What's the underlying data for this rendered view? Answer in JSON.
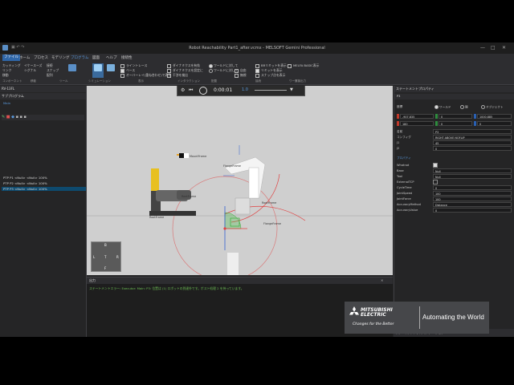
{
  "window": {
    "title": "Robot Reachability Part1_after.vcmx - MELSOFT Gemini Professional",
    "controls": [
      "—",
      "□",
      "✕"
    ]
  },
  "menu": [
    "ファイル",
    "ホーム",
    "プロセス",
    "モデリング",
    "プログラム",
    "図面",
    "ヘルプ",
    "接続性"
  ],
  "menu_active_index": 4,
  "ribbon": {
    "col1": [
      "カッティング",
      "リンク",
      "移動"
    ],
    "col2": [
      "イケースーズ",
      "シグナル",
      ""
    ],
    "col3": [
      "接続",
      "スナップ",
      "配列"
    ],
    "big_buttons": [
      "",
      "",
      ""
    ],
    "display_checks": [
      {
        "label": "ライントレース",
        "on": false
      },
      {
        "label": "ベース",
        "on": true
      },
      {
        "label": "オーバーレイ(重ね合わせ)で表示",
        "on": false
      }
    ],
    "dynamics_checks": [
      {
        "label": "ダイナミクスを有効",
        "on": false
      },
      {
        "label": "ダイナミクスを設定に",
        "on": false
      },
      {
        "label": "干渉を検出",
        "on": false
      }
    ],
    "work_radios": [
      {
        "label": "ワールドに対して",
        "on": true
      },
      {
        "label": "ワールドに対して",
        "on": false
      }
    ],
    "snap_checks": [
      {
        "label": "自由",
        "on": false
      },
      {
        "label": "無視",
        "on": false
      }
    ],
    "bounds_checks": [
      {
        "label": "BRリミットを表示",
        "on": false
      },
      {
        "label": "リミットを表示",
        "on": true
      },
      {
        "label": "スナップ点を表示",
        "on": false
      }
    ],
    "mode_check": {
      "label": "MELFA BASIC表示",
      "on": false
    },
    "groups": [
      "コンポーネント",
      "移動",
      "ツール",
      "シミュレーション",
      "表示",
      "インタラクション",
      "配置",
      "接続",
      "ワーク",
      "実機出力"
    ]
  },
  "left_panel": {
    "header": "RV-13FL",
    "subprogram_header": "サブプログラム",
    "subprogram_item": "Main",
    "statements": [
      "PTP P1 <Null> <Null> 100%",
      "PTP P2 <Null> <Null> 100%",
      "PTP P3 <Null> <Null> 100%"
    ],
    "selected_index": 2
  },
  "viewport": {
    "timer": "0:00:01",
    "speed": "1.0",
    "labels": {
      "frame_a": "MountFrame",
      "frame_b": "FlangeFrame",
      "frame_c": "RootFrame",
      "frame_d": "RootFrame",
      "frame_e": "RootFrame",
      "frame_f": "FlangeFrame"
    },
    "nav_cube": {
      "top": "B",
      "left": "L",
      "right": "R",
      "bottom": "F",
      "center": "T"
    }
  },
  "output": {
    "header": "出力",
    "message": "ステートメントエラー: Executor: Main: P3: 位置は (1) ロボットの到達外です。ポスト処理 2 を持っています。"
  },
  "right_panel": {
    "header": "ステートメントプロパティ",
    "subtab": "P3",
    "coords_label": "座標",
    "coords_options": [
      {
        "label": "ワールド",
        "on": true
      },
      {
        "label": "親",
        "on": false
      },
      {
        "label": "オブジェクト",
        "on": false
      }
    ],
    "pos": {
      "x": "-907.835",
      "y": "0",
      "z": "1000.885"
    },
    "rot": {
      "rx": "180",
      "ry": "0",
      "rz": "0"
    },
    "fields": [
      {
        "label": "名前",
        "value": "P3"
      },
      {
        "label": "コンフィグ",
        "value": "RIGHT ABOVE NOFLIP"
      },
      {
        "label": "J1",
        "value": "45"
      },
      {
        "label": "J2",
        "value": "0"
      }
    ],
    "section": "プロパティ",
    "props": [
      {
        "label": "Whatnot",
        "value": "",
        "check": true
      },
      {
        "label": "Base",
        "value": "Null"
      },
      {
        "label": "Tool",
        "value": "Null"
      },
      {
        "label": "ExternalTCP",
        "value": "",
        "check": false
      },
      {
        "label": "CycleTime",
        "value": "0"
      },
      {
        "label": "JointSpeed",
        "value": "100"
      },
      {
        "label": "JointForce",
        "value": "100"
      },
      {
        "label": "AccuracyMethod",
        "value": "Distance"
      },
      {
        "label": "AccuracyValue",
        "value": "0"
      }
    ],
    "bottom_tabs": [
      "ステートメントプロパティ",
      "ジョグ"
    ]
  },
  "logo": {
    "brand1": "MITSUBISHI",
    "brand2": "ELECTRIC",
    "tagline": "Changes for the Better",
    "slogan": "Automating the World"
  },
  "colors": {
    "accent": "#2f66a8",
    "selection": "#0e4a6e",
    "output_text": "#6dbf55",
    "reach_circle": "#e04040"
  }
}
